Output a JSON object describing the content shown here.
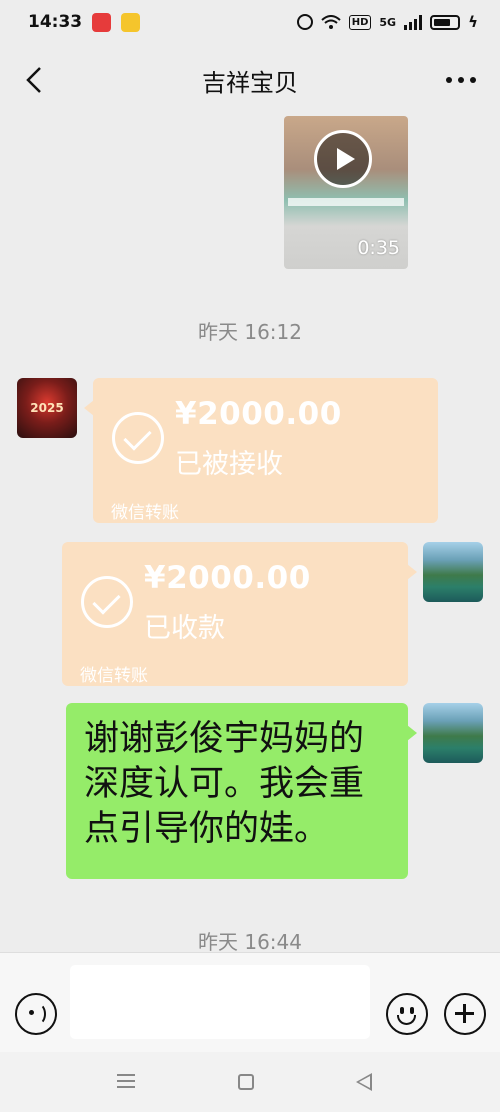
{
  "status_bar": {
    "time": "14:33",
    "network_label": "HD",
    "signal_label": "5G"
  },
  "header": {
    "title": "吉祥宝贝"
  },
  "video": {
    "duration": "0:35"
  },
  "timestamps": [
    "昨天 16:12",
    "昨天 16:44"
  ],
  "sender_avatar": {
    "text": "2025"
  },
  "transfers": [
    {
      "amount": "¥2000.00",
      "status": "已被接收",
      "label": "微信转账",
      "side": "left"
    },
    {
      "amount": "¥2000.00",
      "status": "已收款",
      "label": "微信转账",
      "side": "right"
    }
  ],
  "message": {
    "text": "谢谢彭俊宇妈妈的深度认可。我会重点引导你的娃。"
  },
  "colors": {
    "background": "#ededed",
    "transfer_card": "#fbe0c2",
    "my_bubble": "#95ec69"
  },
  "icons": {
    "back": "chevron-left-icon",
    "more": "more-dots-icon",
    "voice": "voice-icon",
    "emoji": "emoji-icon",
    "plus": "plus-icon"
  }
}
